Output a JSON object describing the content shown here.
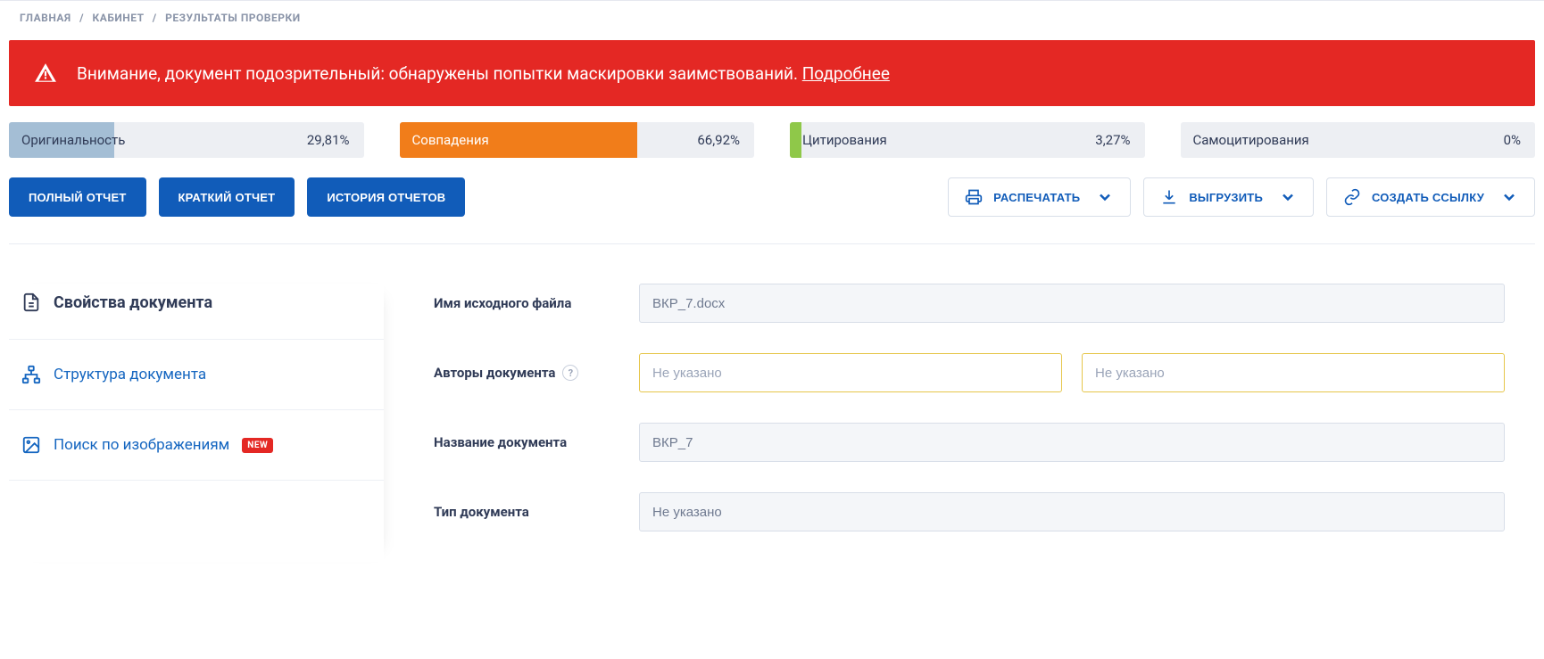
{
  "breadcrumbs": {
    "home": "ГЛАВНАЯ",
    "cabinet": "КАБИНЕТ",
    "current": "РЕЗУЛЬТАТЫ ПРОВЕРКИ"
  },
  "alert": {
    "text": "Внимание, документ подозрительный: обнаружены попытки маскировки заимствований. ",
    "more": "Подробнее"
  },
  "stats": {
    "originality": {
      "label": "Оригинальность",
      "value": "29,81%",
      "pct": 29.81,
      "color": "#a4bed5"
    },
    "matches": {
      "label": "Совпадения",
      "value": "66,92%",
      "pct": 66.92,
      "color": "#f17d1a"
    },
    "citations": {
      "label": "Цитирования",
      "value": "3,27%",
      "pct": 3.27,
      "color": "#8fc849"
    },
    "selfcite": {
      "label": "Самоцитирования",
      "value": "0%",
      "pct": 0
    }
  },
  "buttons": {
    "full_report": "ПОЛНЫЙ ОТЧЕТ",
    "short_report": "КРАТКИЙ ОТЧЕТ",
    "history": "ИСТОРИЯ ОТЧЕТОВ",
    "print": "РАСПЕЧАТАТЬ",
    "export": "ВЫГРУЗИТЬ",
    "share": "СОЗДАТЬ ССЫЛКУ"
  },
  "side": {
    "props_title": "Свойства документа",
    "structure": "Структура документа",
    "image_search": "Поиск по изображениям",
    "new_badge": "NEW"
  },
  "props": {
    "source_name_label": "Имя исходного файла",
    "source_name_value": "ВКР_7.docx",
    "authors_label": "Авторы документа",
    "author_placeholder": "Не указано",
    "doc_name_label": "Название документа",
    "doc_name_value": "ВКР_7",
    "doc_type_label": "Тип документа",
    "doc_type_value": "Не указано"
  }
}
